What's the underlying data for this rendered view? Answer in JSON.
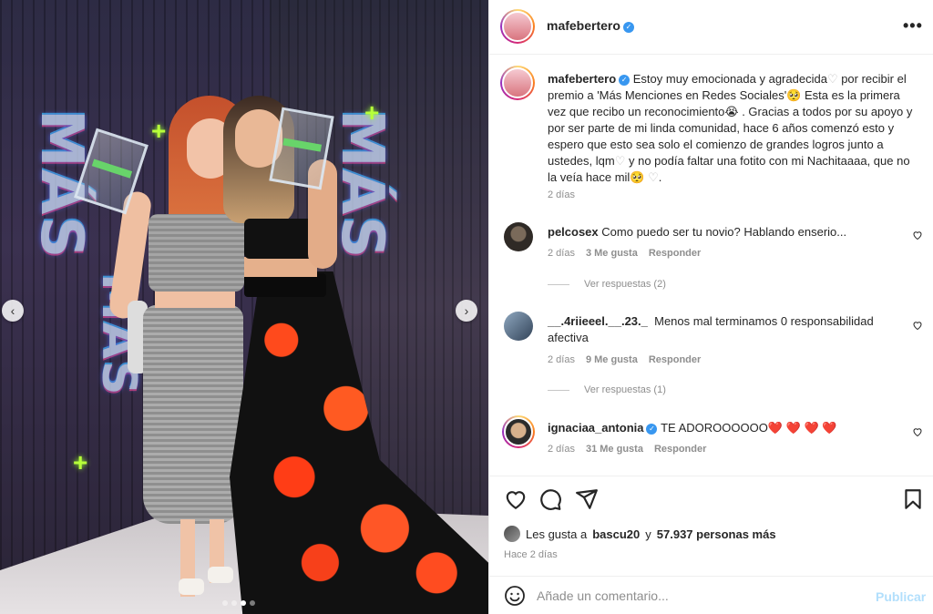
{
  "post": {
    "username": "mafebertero",
    "more_glyph": "•••",
    "verified_glyph": "✓",
    "caption_part1": " Estoy muy emocionada y agradecida",
    "caption_part2": " por recibir el premio a 'Más Menciones en Redes Sociales'",
    "caption_part3": "  Esta es la primera vez que recibo un reconocimiento",
    "caption_part4": " . Gracias a todos por su apoyo y por ser parte de mi linda comunidad, hace 6 años comenzó esto y espero que esto sea solo el comienzo de grandes logros junto a ustedes, lqm",
    "caption_part5": "  y no podía faltar una fotito con mi Nachitaaaa, que no la veía hace mil",
    "caption_emoji_heart": "♡",
    "caption_emoji_face": "🥺",
    "caption_emoji_cry": "😭",
    "caption_time": "2 días"
  },
  "carousel": {
    "prev_glyph": "‹",
    "next_glyph": "›",
    "slide_count": 4,
    "active_slide": 3
  },
  "photo_text": {
    "neon_1": "MÁS",
    "neon_2": "MÁS",
    "neon_3": "MÁS",
    "plus": "+"
  },
  "comments": [
    {
      "username": "pelcosex",
      "text": "Como puedo ser tu novio? Hablando enserio...",
      "time": "2 días",
      "likes": "3 Me gusta",
      "reply": "Responder",
      "verified": false,
      "view_replies": "Ver respuestas (2)"
    },
    {
      "username": "__.4riieeel.__.23._",
      "text": "Menos mal terminamos 0 responsabilidad afectiva",
      "time": "2 días",
      "likes": "9 Me gusta",
      "reply": "Responder",
      "verified": false,
      "view_replies": "Ver respuestas (1)"
    },
    {
      "username": "ignaciaa_antonia",
      "text": "TE ADOROOOOOO",
      "hearts": "❤️ ❤️ ❤️ ❤️",
      "time": "2 días",
      "likes": "31 Me gusta",
      "reply": "Responder",
      "verified": true
    }
  ],
  "likes_summary": {
    "prefix": "Les gusta a",
    "user": "bascu20",
    "middle": "y",
    "others": "57.937 personas más"
  },
  "post_time": "Hace 2 días",
  "add_comment": {
    "placeholder": "Añade un comentario...",
    "publish": "Publicar"
  },
  "colors": {
    "verified": "#3897f0",
    "muted": "#8e8e8e",
    "publish_disabled": "#b2dffc",
    "heart_red": "#ed4956"
  }
}
